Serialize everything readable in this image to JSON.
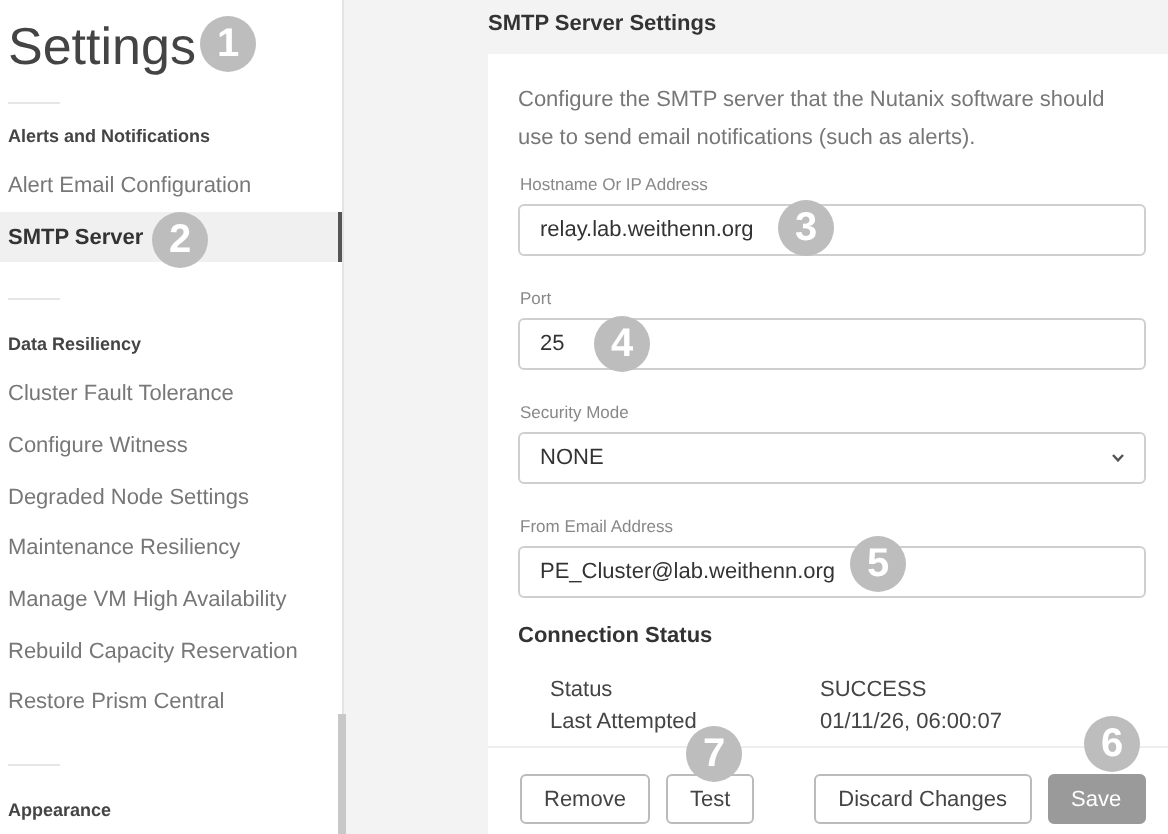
{
  "sidebar": {
    "title": "Settings",
    "sections": [
      {
        "header": "Alerts and Notifications",
        "items": [
          {
            "label": "Alert Email Configuration",
            "selected": false
          },
          {
            "label": "SMTP Server",
            "selected": true
          }
        ]
      },
      {
        "header": "Data Resiliency",
        "items": [
          {
            "label": "Cluster Fault Tolerance",
            "selected": false
          },
          {
            "label": "Configure Witness",
            "selected": false
          },
          {
            "label": "Degraded Node Settings",
            "selected": false
          },
          {
            "label": "Maintenance Resiliency",
            "selected": false
          },
          {
            "label": "Manage VM High Availability",
            "selected": false
          },
          {
            "label": "Rebuild Capacity Reservation",
            "selected": false
          },
          {
            "label": "Restore Prism Central",
            "selected": false
          }
        ]
      },
      {
        "header": "Appearance"
      }
    ]
  },
  "panel": {
    "title": "SMTP Server Settings",
    "description": "Configure the SMTP server that the Nutanix software should use to send email notifications (such as alerts).",
    "fields": [
      {
        "kind": "input",
        "label": "Hostname Or IP Address",
        "value": "relay.lab.weithenn.org"
      },
      {
        "kind": "input",
        "label": "Port",
        "value": "25"
      },
      {
        "kind": "select",
        "label": "Security Mode",
        "value": "NONE"
      },
      {
        "kind": "input",
        "label": "From Email Address",
        "value": "PE_Cluster@lab.weithenn.org"
      }
    ],
    "connection_status": {
      "title": "Connection Status",
      "rows": [
        {
          "label": "Status",
          "value": "SUCCESS"
        },
        {
          "label": "Last Attempted",
          "value": "01/11/26, 06:00:07"
        }
      ]
    },
    "buttons": [
      {
        "label": "Remove",
        "disabled": false
      },
      {
        "label": "Test",
        "disabled": false
      },
      {
        "label": "Discard Changes",
        "disabled": false
      },
      {
        "label": "Save",
        "disabled": true
      }
    ]
  },
  "callouts": [
    "1",
    "2",
    "3",
    "4",
    "5",
    "6",
    "7"
  ]
}
